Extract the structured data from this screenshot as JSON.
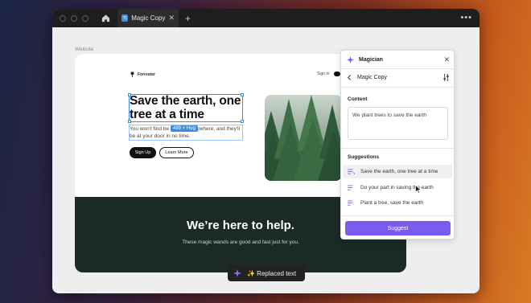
{
  "browser": {
    "tab_title": "Magic Copy",
    "tab_favicon_text": "Tt",
    "new_tab_icon": "plus-icon",
    "menu_icon": "more-dots-icon"
  },
  "canvas": {
    "frame_label": "Website"
  },
  "site": {
    "brand": "Forrester",
    "nav_signin": "Sign In",
    "hero_title": "Save the earth, one tree at a time",
    "hero_sub": "You won't find be               anywhere, and they'll be at your door in no time.",
    "size_badge": "489 × Hug",
    "btn_signup": "Sign Up",
    "btn_learn": "Learn More",
    "dark_title": "We’re here to help.",
    "dark_sub": "These magic wands are good and fast just for you."
  },
  "panel": {
    "title": "Magician",
    "subtitle": "Magic Copy",
    "content_label": "Content",
    "content_value": "We plant trees to save the earth",
    "suggestions_label": "Suggestions",
    "suggestions": [
      "Save the earth, one tree at a time",
      "Do your part in saving the earth",
      "Plant a tree, save the earth"
    ],
    "suggest_button": "Suggest",
    "accent": "#7b5cf0"
  },
  "toast": {
    "text": "✨ Replaced text"
  }
}
